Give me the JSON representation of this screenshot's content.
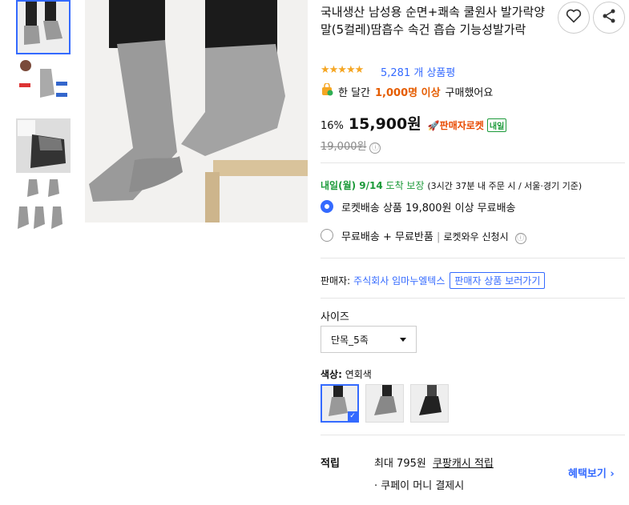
{
  "product": {
    "title": "국내생산 남성용 순면+쾌속 쿨원사 발가락양말(5컬레)땀흡수 속건 흡습 기능성발가락",
    "rating_stars": "★★★★★",
    "review_count": "5,281 개 상품평",
    "bought_prefix": "한 달간",
    "bought_highlight": "1,000명 이상",
    "bought_suffix": "구매했어요"
  },
  "price": {
    "discount": "16%",
    "sale": "15,900원",
    "rocket_label": "판매자로켓",
    "naeil_badge": "내일",
    "original": "19,000원",
    "info_icon": "ⓘ"
  },
  "delivery": {
    "date": "내일(월) 9/14",
    "guarantee": "도착 보장",
    "note": "(3시간 37분 내 주문 시 / 서울·경기 기준)",
    "option1": "로켓배송 상품 19,800원 이상 무료배송",
    "option2_a": "무료배송 + 무료반품",
    "option2_b": "로켓와우 신청시"
  },
  "seller": {
    "label": "판매자:",
    "name": "주식회사 임마누엘텍스",
    "button": "판매자 상품 보러가기"
  },
  "size": {
    "label": "사이즈",
    "selected": "단목_5족"
  },
  "color": {
    "label": "색상:",
    "selected": "연회색"
  },
  "points": {
    "label": "적립",
    "max": "최대 795원",
    "cash": "쿠팡캐시 적립",
    "pay": "· 쿠페이 머니 결제시",
    "benefit_link": "혜택보기"
  },
  "colors": {
    "accent": "#346aff",
    "orange": "#e55c00",
    "green": "#1c9a3a",
    "star": "#f5a623"
  }
}
